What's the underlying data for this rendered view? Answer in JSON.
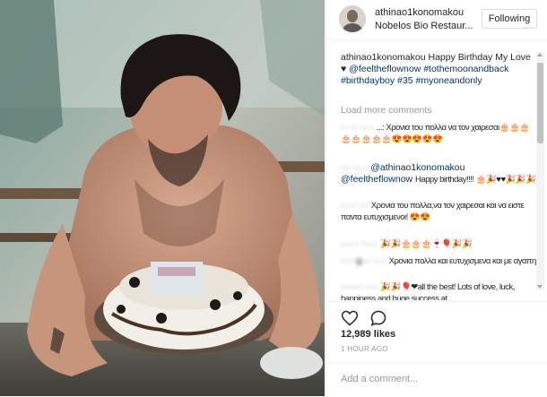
{
  "post": {
    "username": "athinao1konomakou",
    "location": "Nobelos Bio Restaur...",
    "follow_label": "Following",
    "caption_user": "athinao1konomakou",
    "caption_text": "Happy Birthday My Love ♥",
    "caption_tags": [
      "@feeltheflownow",
      "#tothemoonandback",
      "#birthdayboy",
      "#35",
      "#myoneandonly"
    ],
    "load_more": "Load more comments",
    "likes": "12,989 likes",
    "time": "1 HOUR AGO",
    "add_comment_placeholder": "Add a comment..."
  },
  "comments": [
    {
      "user": "·· ··· ·· ·",
      "text": "...: Χρονια του πολλα να τον χαιρεσαι🎂🎂🎂🎂🎂🎂🎂🎂😍😍😍😍😍"
    },
    {
      "user": "··· ··· ·",
      "mention1": "@athinao1konomakou",
      "mention2": "@feeltheflownow",
      "text": "Happy birthday!!!! 🎂🎉♥♥🎉🎉🎉"
    },
    {
      "user": "····· ···",
      "text": "Χρονια του πολλα,να τον χαιρεσαι και να ειστε παντα ευτυχισμενοι! 😍😍"
    },
    {
      "user": "······ ·····",
      "text": "🎉🎉🎂🎂🎂🍷🎈🎉🎉"
    },
    {
      "user": "·····g··· ····",
      "text": "Χρονια πολλα και ευτυχισμενα και με αγαπη"
    },
    {
      "user": "······· ····",
      "text": "🎉🎉🎈❤all the best! Lots of love, luck, happiness and huge success at"
    }
  ],
  "icons": {
    "like": "heart-icon",
    "comment": "speech-bubble-icon"
  },
  "colors": {
    "link": "#003569",
    "muted": "#999999",
    "border": "#efefef",
    "text": "#262626"
  }
}
